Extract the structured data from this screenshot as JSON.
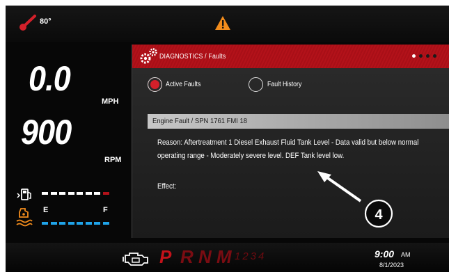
{
  "status": {
    "temperature": "80°",
    "warning_icon": "warning-triangle-icon",
    "colors": {
      "warning": "#f28c1c",
      "thermo": "#d3202a"
    }
  },
  "gauges": {
    "speed_value": "0.0",
    "speed_unit": "MPH",
    "rpm_value": "900",
    "rpm_unit": "RPM",
    "fuel": {
      "icon": "fuel-pump-icon",
      "segments": 8,
      "level_fraction": 1.0,
      "colors": {
        "fill": "#ffffff",
        "low": "#b3121a"
      }
    },
    "def": {
      "icon": "def-tank-icon",
      "empty_label": "E",
      "full_label": "F",
      "segments": 8,
      "level_fraction": 1.0,
      "colors": {
        "fill": "#1fa3e8",
        "icon": "#f28c1c"
      }
    }
  },
  "diagnostics": {
    "icon": "gears-icon",
    "title": "DIAGNOSTICS / Faults",
    "page_dots": 4,
    "active_page": 1,
    "tabs": [
      {
        "label": "Active Faults",
        "selected": true
      },
      {
        "label": "Fault History",
        "selected": false
      }
    ],
    "fault": {
      "title": "Engine Fault / SPN 1761 FMI 18",
      "reason": "Reason: Aftertreatment 1 Diesel Exhaust Fluid Tank Level - Data valid but below normal operating range - Moderately severe level.  DEF Tank level low.",
      "effect": "Effect:"
    },
    "callout": "4",
    "colors": {
      "header": "#b3121a",
      "selected_radio": "#d3202a"
    }
  },
  "transmission": {
    "engine_icon": "engine-icon",
    "gears": [
      "P",
      "R",
      "N",
      "M"
    ],
    "gear_numbers": "1234",
    "active_gear": "P",
    "colors": {
      "active": "#c3121a",
      "inactive": "#7a0c12"
    }
  },
  "clock": {
    "time": "9:00",
    "ampm": "AM",
    "date": "8/1/2023"
  }
}
